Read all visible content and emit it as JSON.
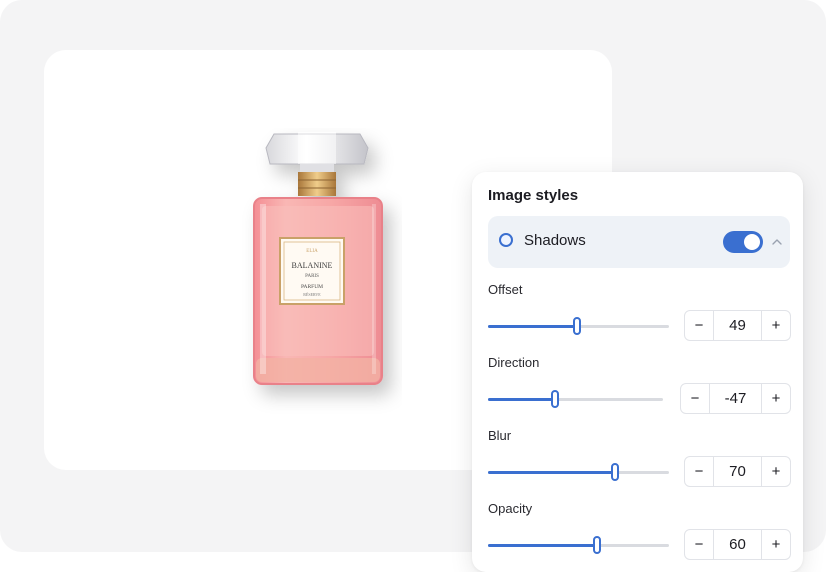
{
  "panel": {
    "title": "Image styles",
    "section": {
      "label": "Shadows",
      "toggle_on": true,
      "icon": "radio-icon",
      "collapse_icon": "chevron-up-icon"
    },
    "controls": [
      {
        "label": "Offset",
        "value": "49",
        "slider_fraction": 0.49,
        "minus": "−",
        "plus": "+"
      },
      {
        "label": "Direction",
        "value": "-47",
        "slider_fraction": 0.38,
        "minus": "−",
        "plus": "+"
      },
      {
        "label": "Blur",
        "value": "70",
        "slider_fraction": 0.7,
        "minus": "−",
        "plus": "+"
      },
      {
        "label": "Opacity",
        "value": "60",
        "slider_fraction": 0.6,
        "minus": "−",
        "plus": "+"
      }
    ]
  },
  "product_label": {
    "line1": "ELIA",
    "line2": "BALANINE",
    "line3": "PARIS",
    "line4": "PARFUM",
    "line5": "RÉSERVE"
  },
  "colors": {
    "accent": "#3a6fd0",
    "bottle": "#f5a6a6",
    "cap_gold": "#c99a52"
  }
}
